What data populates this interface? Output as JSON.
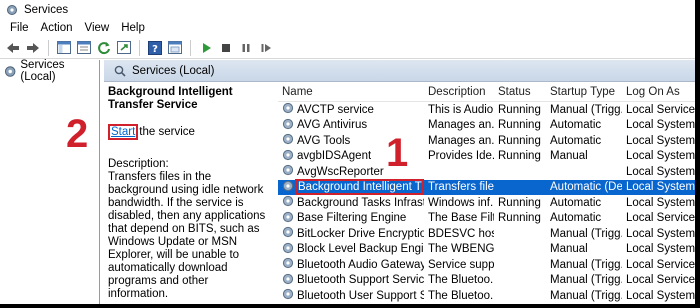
{
  "window": {
    "title": "Services"
  },
  "menu": [
    "File",
    "Action",
    "View",
    "Help"
  ],
  "toolbar": [
    "back-icon",
    "forward-icon",
    "console-tree-icon",
    "properties-icon",
    "refresh-icon",
    "export-icon",
    "help-icon",
    "console-icon",
    "start-icon",
    "stop-icon",
    "pause-icon",
    "restart-icon"
  ],
  "tree": {
    "root_label": "Services (Local)"
  },
  "pane": {
    "header_label": "Services (Local)"
  },
  "details": {
    "service_title": "Background Intelligent Transfer Service",
    "start_link": "Start",
    "start_suffix": "the service",
    "description_label": "Description:",
    "description_text": "Transfers files in the background using idle network bandwidth. If the service is disabled, then any applications that depend on BITS, such as Windows Update or MSN Explorer, will be unable to automatically download programs and other information."
  },
  "list": {
    "columns": {
      "name": "Name",
      "description": "Description",
      "status": "Status",
      "startup": "Startup Type",
      "logon": "Log On As"
    },
    "rows": [
      {
        "name": "AVCTP service",
        "description": "This is Audio...",
        "status": "Running",
        "startup": "Manual (Trigg...",
        "logon": "Local Service"
      },
      {
        "name": "AVG Antivirus",
        "description": "Manages an...",
        "status": "Running",
        "startup": "Automatic",
        "logon": "Local System"
      },
      {
        "name": "AVG Tools",
        "description": "Manages an...",
        "status": "Running",
        "startup": "Automatic",
        "logon": "Local System"
      },
      {
        "name": "avgbIDSAgent",
        "description": "Provides Ide...",
        "status": "Running",
        "startup": "Manual",
        "logon": "Local System"
      },
      {
        "name": "AvgWscReporter",
        "description": "",
        "status": "",
        "startup": "",
        "logon": "Local System"
      },
      {
        "name": "Background Intelligent Tran...",
        "description": "Transfers file...",
        "status": "",
        "startup": "Automatic (De...",
        "logon": "Local System",
        "selected": true
      },
      {
        "name": "Background Tasks Infrastruc...",
        "description": "Windows inf...",
        "status": "Running",
        "startup": "Automatic",
        "logon": "Local System"
      },
      {
        "name": "Base Filtering Engine",
        "description": "The Base Filt...",
        "status": "Running",
        "startup": "Automatic",
        "logon": "Local Service"
      },
      {
        "name": "BitLocker Drive Encryption S...",
        "description": "BDESVC hos...",
        "status": "",
        "startup": "Manual (Trigg...",
        "logon": "Local System"
      },
      {
        "name": "Block Level Backup Engine S...",
        "description": "The WBENGI...",
        "status": "",
        "startup": "Manual",
        "logon": "Local System"
      },
      {
        "name": "Bluetooth Audio Gateway Se...",
        "description": "Service supp...",
        "status": "",
        "startup": "Manual (Trigg...",
        "logon": "Local Service"
      },
      {
        "name": "Bluetooth Support Service",
        "description": "The Bluetoo...",
        "status": "",
        "startup": "Manual (Trigg...",
        "logon": "Local Service"
      },
      {
        "name": "Bluetooth User Support Servi...",
        "description": "The Bluetoo...",
        "status": "",
        "startup": "Manual (Trigg...",
        "logon": "Local System"
      }
    ]
  },
  "callouts": {
    "one": "1",
    "two": "2"
  },
  "colors": {
    "selection": "#0a66cf",
    "callout": "#d0202c",
    "link": "#0066cc"
  }
}
